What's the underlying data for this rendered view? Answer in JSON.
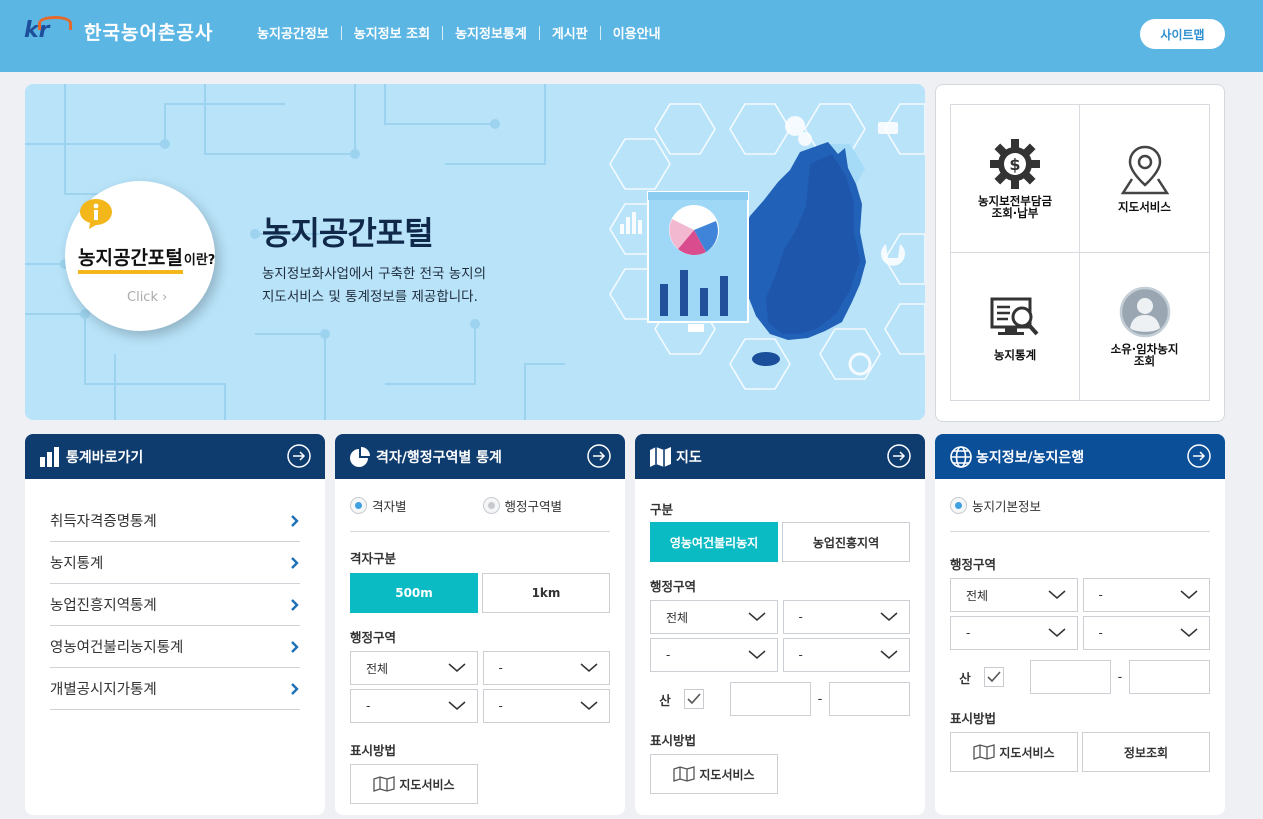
{
  "header": {
    "logo_text": "한국농어촌공사",
    "nav": [
      "농지공간정보",
      "농지정보 조회",
      "농지정보통계",
      "게시판",
      "이용안내"
    ],
    "sitemap_label": "사이트맵"
  },
  "hero": {
    "circle_title": "농지공간포털",
    "circle_suffix": "이란?",
    "circle_click": "Click",
    "title": "농지공간포털",
    "desc_line1": "농지정보화사업에서 구축한 전국 농지의",
    "desc_line2": "지도서비스 및 통계정보를 제공합니다."
  },
  "quick_links": [
    {
      "label": "농지보전부담금\n조회·납부",
      "icon": "gear-dollar-icon"
    },
    {
      "label": "지도서비스",
      "icon": "map-pin-icon"
    },
    {
      "label": "농지통계",
      "icon": "monitor-search-icon"
    },
    {
      "label": "소유·임차농지\n조회",
      "icon": "user-profile-icon"
    }
  ],
  "stats_card": {
    "title": "통계바로가기",
    "items": [
      "취득자격증명통계",
      "농지통계",
      "농업진흥지역통계",
      "영농여건불리농지통계",
      "개별공시지가통계"
    ]
  },
  "grid_card": {
    "title": "격자/행정구역별 통계",
    "radio1": "격자별",
    "radio2": "행정구역별",
    "grid_label": "격자구분",
    "grid_opt1": "500m",
    "grid_opt2": "1km",
    "admin_label": "행정구역",
    "sel1": "전체",
    "sel2": "-",
    "sel3": "-",
    "sel4": "-",
    "display_label": "표시방법",
    "map_btn": "지도서비스"
  },
  "map_card": {
    "title": "지도",
    "type_label": "구분",
    "type_opt1": "영농여건불리농지",
    "type_opt2": "농업진흥지역",
    "admin_label": "행정구역",
    "sel1": "전체",
    "sel2": "-",
    "sel3": "-",
    "sel4": "-",
    "san_label": "산",
    "dash": "-",
    "display_label": "표시방법",
    "map_btn": "지도서비스"
  },
  "bank_card": {
    "title": "농지정보/농지은행",
    "radio1": "농지기본정보",
    "admin_label": "행정구역",
    "sel1": "전체",
    "sel2": "-",
    "sel3": "-",
    "sel4": "-",
    "san_label": "산",
    "dash": "-",
    "display_label": "표시방법",
    "map_btn": "지도서비스",
    "info_btn": "정보조회"
  },
  "colors": {
    "topbar": "#5cb6e4",
    "card_header": "#0f3c6e",
    "card_header_alt": "#0b4f99",
    "accent_teal": "#0abbc4",
    "hero_bg": "#b8e3f9"
  }
}
